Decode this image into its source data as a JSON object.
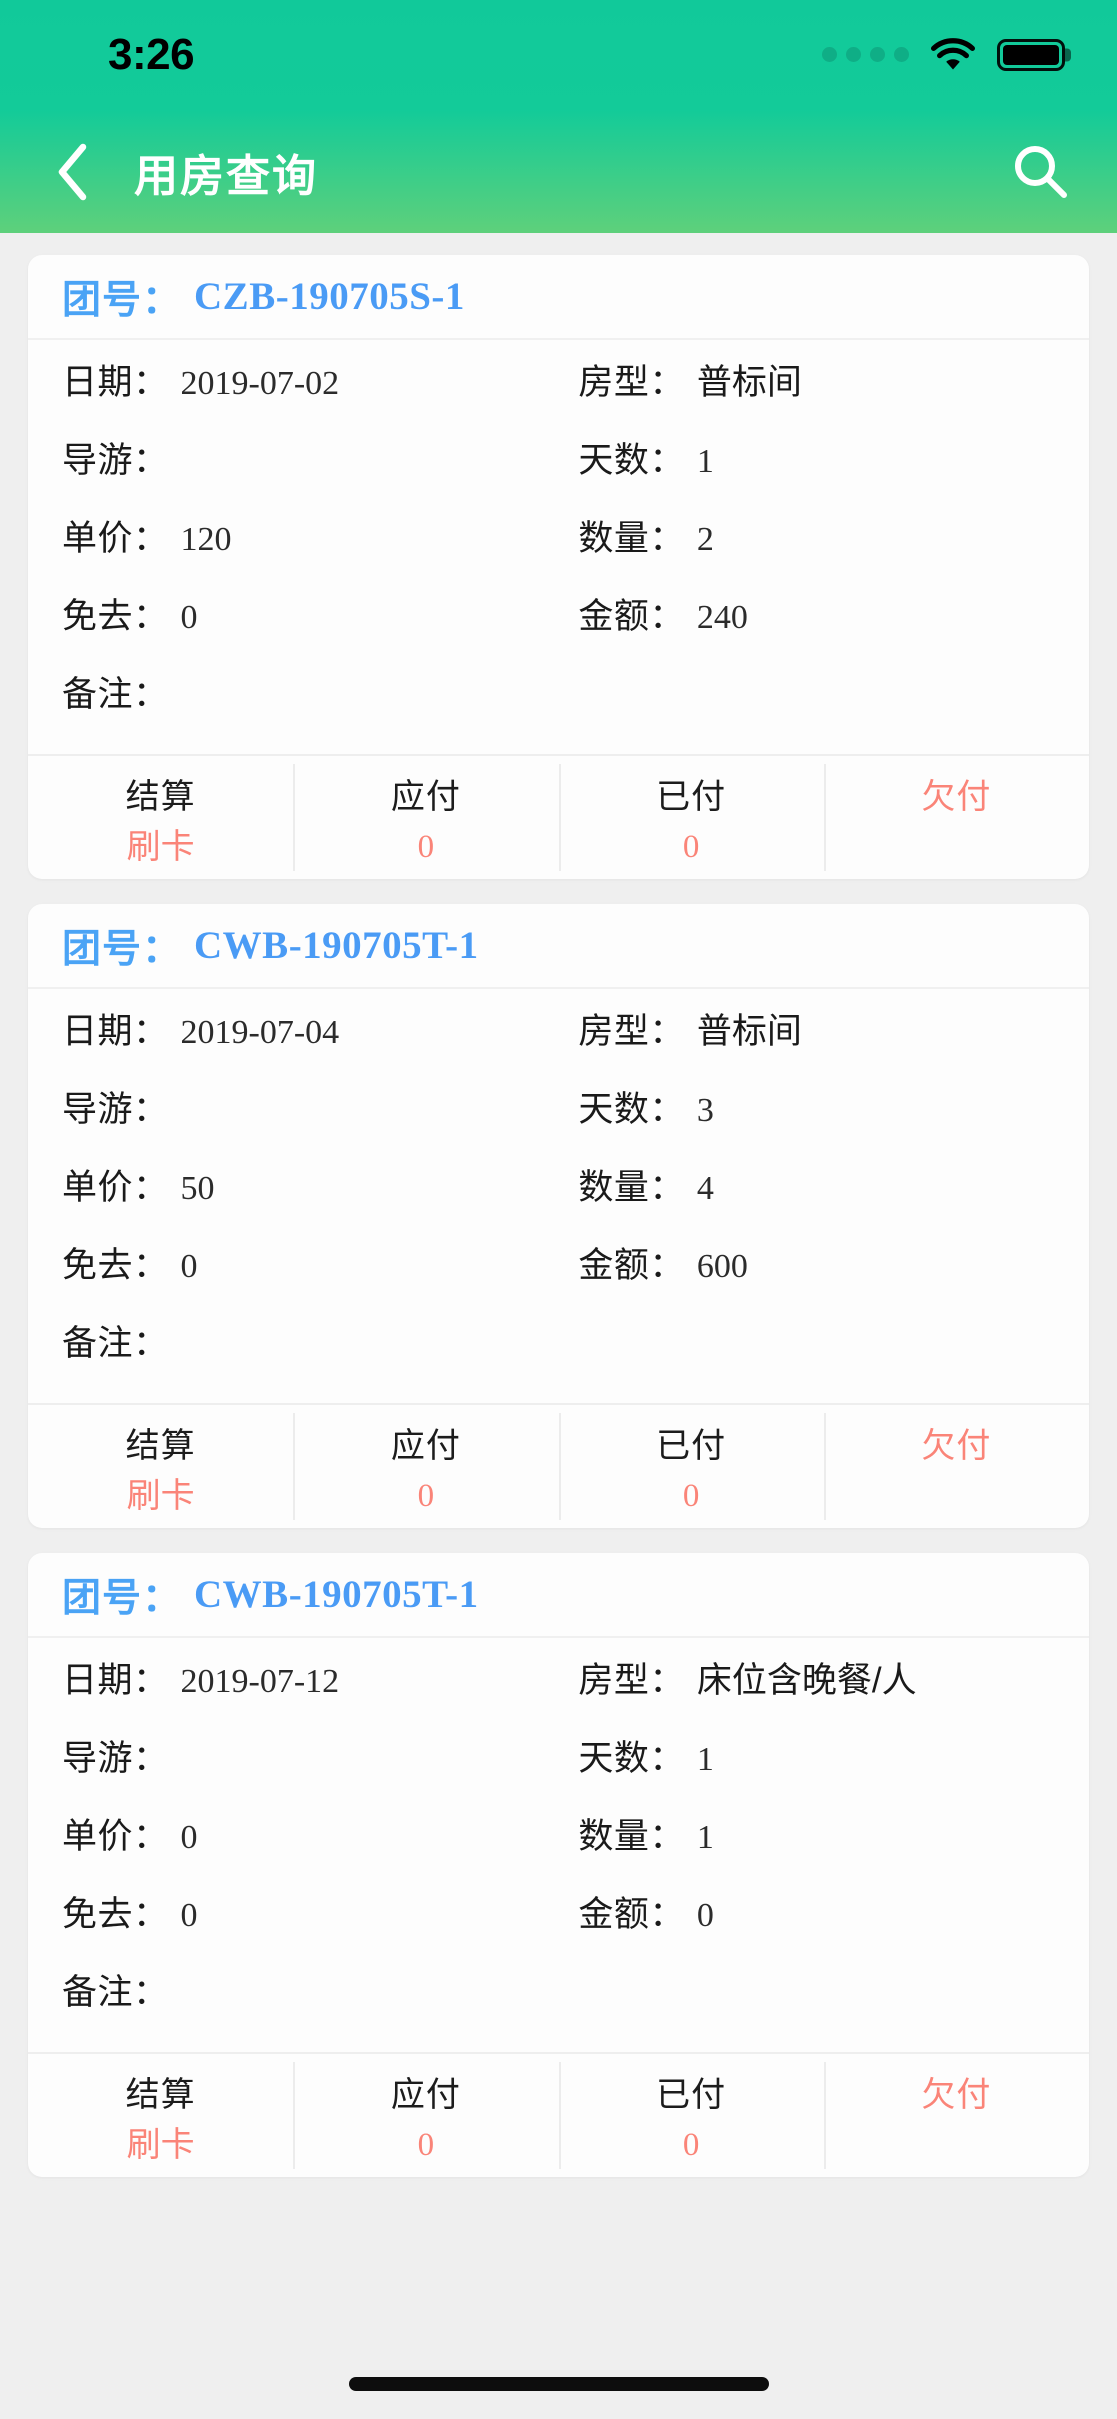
{
  "status_bar": {
    "time": "3:26",
    "signal_icon": "signal-dots-icon",
    "wifi_icon": "wifi-icon",
    "battery_icon": "battery-full-icon"
  },
  "nav": {
    "back_icon": "chevron-left-icon",
    "title": "用房查询",
    "search_icon": "search-icon"
  },
  "theme": {
    "gradient_top": "#11c99a",
    "gradient_bottom": "#5ed07b",
    "page_bg": "#efefef",
    "card_bg": "#fdfdfd",
    "link_blue": "#4a9bf5",
    "accent_red": "#fa8478",
    "text_dark": "#1a1a1a"
  },
  "labels": {
    "group_no": "团号：",
    "date": "日期：",
    "room_type": "房型：",
    "guide": "导游：",
    "days": "天数：",
    "unit_price": "单价：",
    "quantity": "数量：",
    "waived": "免去：",
    "amount": "金额：",
    "remark": "备注：",
    "settle": "结算",
    "payable": "应付",
    "paid": "已付",
    "unpaid": "欠付"
  },
  "cards": [
    {
      "group_no": "CZB-190705S-1",
      "date": "2019-07-02",
      "room_type": "普标间",
      "guide": "",
      "days": "1",
      "unit_price": "120",
      "quantity": "2",
      "waived": "0",
      "amount": "240",
      "remark": "",
      "settle_value": "刷卡",
      "payable_value": "0",
      "paid_value": "0",
      "unpaid_value": ""
    },
    {
      "group_no": "CWB-190705T-1",
      "date": "2019-07-04",
      "room_type": "普标间",
      "guide": "",
      "days": "3",
      "unit_price": "50",
      "quantity": "4",
      "waived": "0",
      "amount": "600",
      "remark": "",
      "settle_value": "刷卡",
      "payable_value": "0",
      "paid_value": "0",
      "unpaid_value": ""
    },
    {
      "group_no": "CWB-190705T-1",
      "date": "2019-07-12",
      "room_type": "床位含晚餐/人",
      "guide": "",
      "days": "1",
      "unit_price": "0",
      "quantity": "1",
      "waived": "0",
      "amount": "0",
      "remark": "",
      "settle_value": "刷卡",
      "payable_value": "0",
      "paid_value": "0",
      "unpaid_value": ""
    }
  ]
}
